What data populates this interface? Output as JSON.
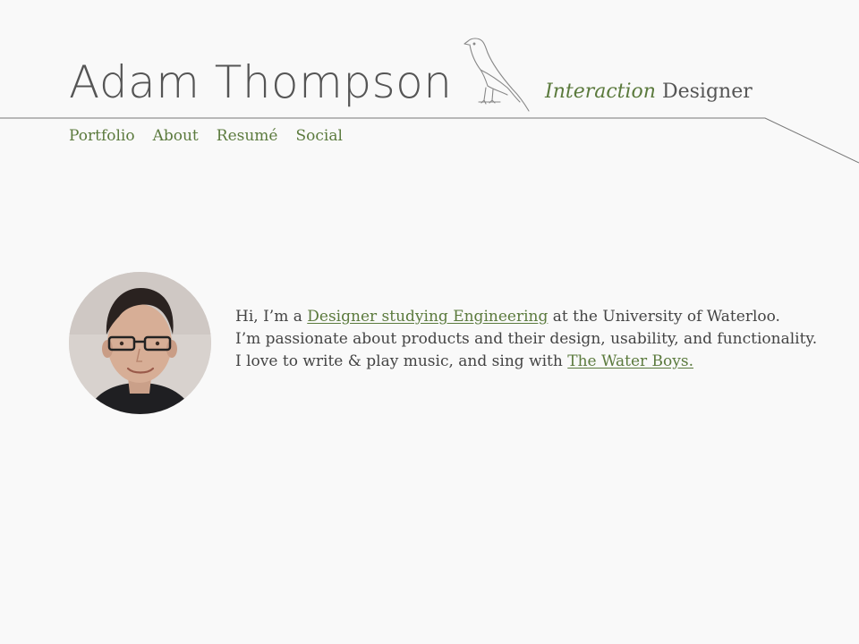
{
  "header": {
    "name": "Adam Thompson",
    "tagline_em": "Interaction",
    "tagline_rest": " Designer",
    "logo_icon": "bird-icon"
  },
  "nav": {
    "items": [
      {
        "label": "Portfolio"
      },
      {
        "label": "About"
      },
      {
        "label": "Resumé"
      },
      {
        "label": "Social"
      }
    ]
  },
  "bio": {
    "line1_pre": "Hi, I’m a ",
    "line1_link": "Designer studying Engineering",
    "line1_post": " at the University of Waterloo.",
    "line2": "I’m passionate about products and their design, usability, and functionality.",
    "line3_pre": "I love to write & play music, and sing with ",
    "line3_link": "The Water Boys."
  },
  "colors": {
    "accent_green": "#5b7a3d",
    "text": "#444444",
    "background": "#f9f9f9"
  }
}
